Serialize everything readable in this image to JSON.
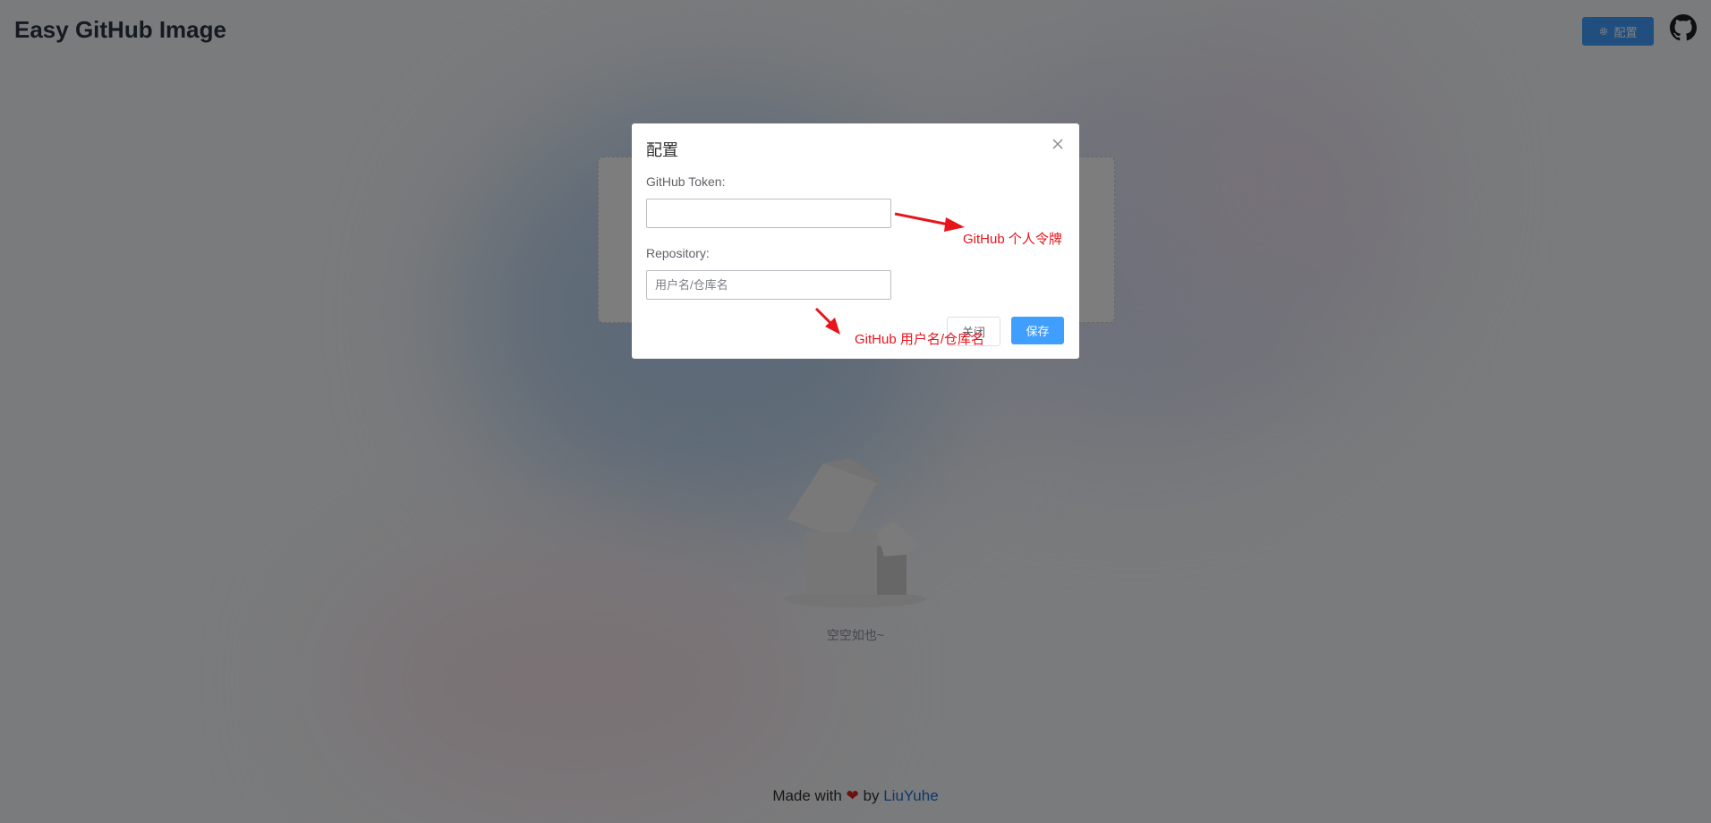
{
  "header": {
    "app_title": "Easy GitHub Image",
    "settings_label": "配置",
    "settings_icon": "gear-icon",
    "github_icon": "github-icon",
    "brand_color": "#409eff"
  },
  "main": {
    "empty_text": "空空如也~",
    "empty_icon": "empty-box-illustration"
  },
  "footer": {
    "made_with": "Made with",
    "heart": "❤",
    "by": "by",
    "author": "LiuYuhe"
  },
  "dialog": {
    "title": "配置",
    "close_icon": "close-icon",
    "token_label": "GitHub Token:",
    "token_value": "",
    "repo_label": "Repository:",
    "repo_value": "",
    "repo_placeholder": "用户名/仓库名",
    "cancel_label": "关闭",
    "save_label": "保存"
  },
  "annotations": {
    "token_note": "GitHub 个人令牌",
    "repo_note": "GitHub 用户名/仓库名",
    "color": "#e8141c"
  }
}
